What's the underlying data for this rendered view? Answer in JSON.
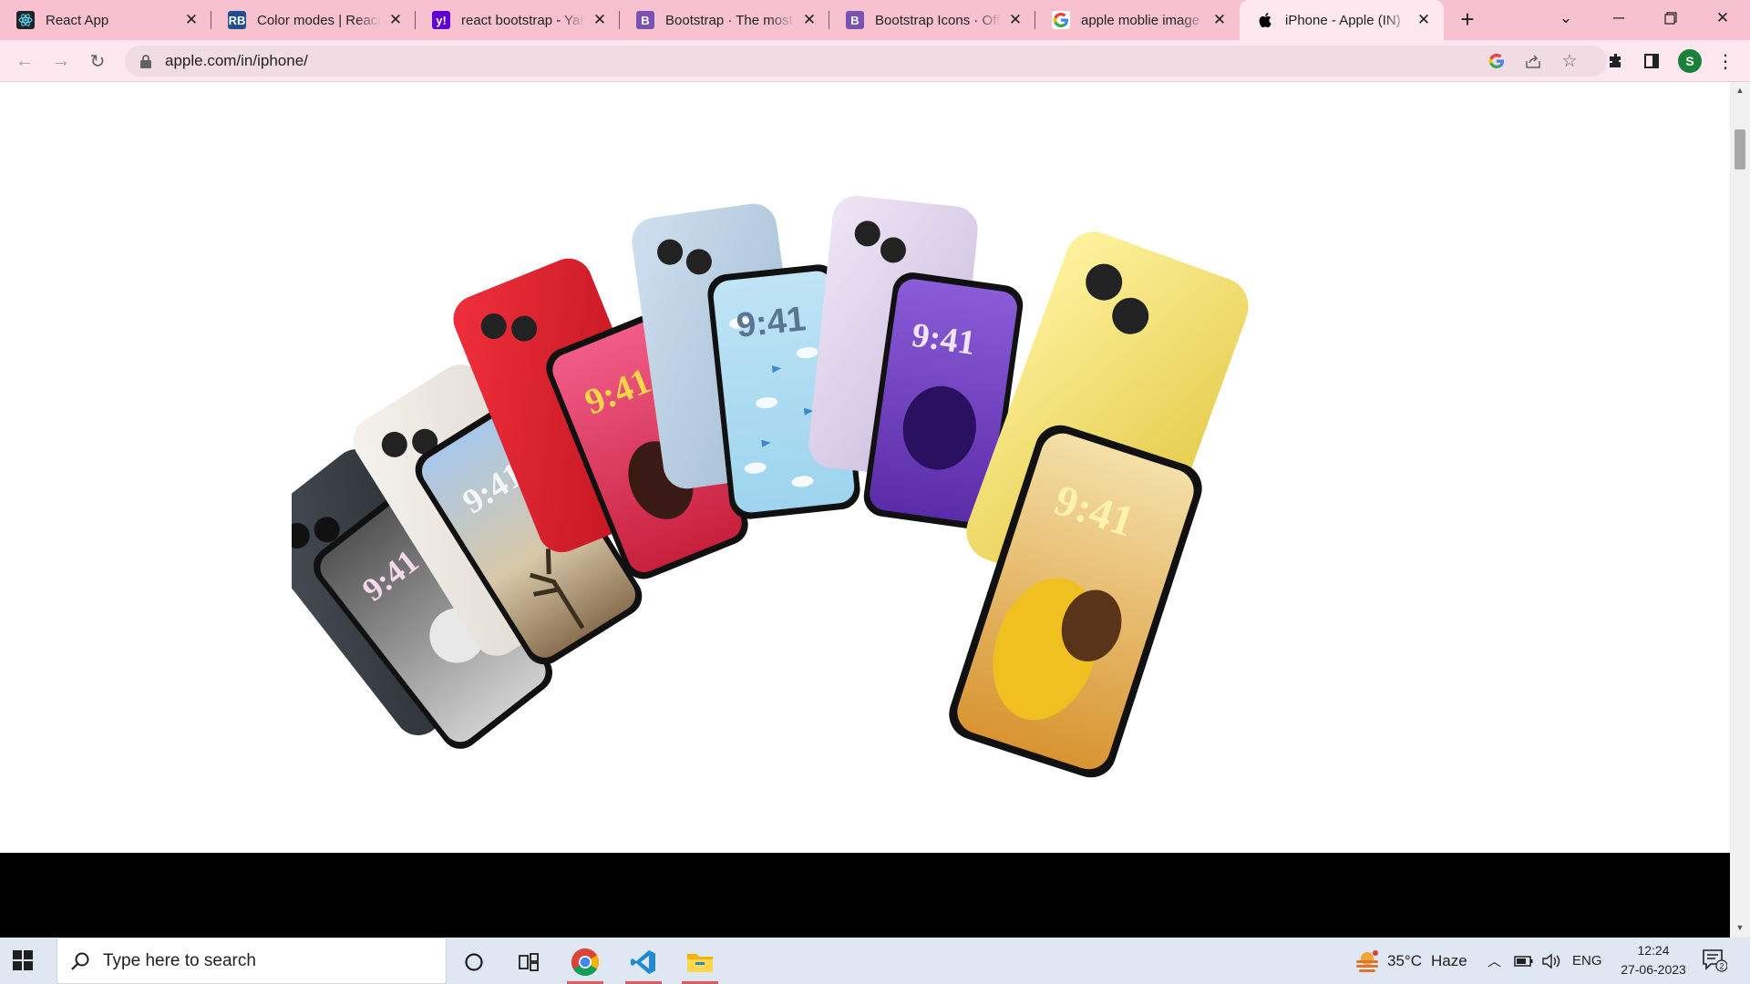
{
  "browser": {
    "tabs": [
      {
        "title": "React App",
        "favicon": "react-icon",
        "favicon_bg": "#20232a",
        "active": false
      },
      {
        "title": "Color modes | React B",
        "favicon": "react-bootstrap-icon",
        "favicon_bg": "#1f4f8f",
        "active": false
      },
      {
        "title": "react bootstrap - Yaho",
        "favicon": "yahoo-icon",
        "favicon_bg": "#6001d2",
        "active": false
      },
      {
        "title": "Bootstrap · The most p",
        "favicon": "bootstrap-icon",
        "favicon_bg": "#7952b3",
        "active": false
      },
      {
        "title": "Bootstrap Icons · Offic",
        "favicon": "bootstrap-icon",
        "favicon_bg": "#7952b3",
        "active": false
      },
      {
        "title": "apple moblie image fo",
        "favicon": "google-icon",
        "favicon_bg": "#ffffff",
        "active": false
      },
      {
        "title": "iPhone - Apple (IN)",
        "favicon": "apple-icon",
        "favicon_bg": "#fce8ee",
        "active": true
      }
    ],
    "new_tab_label": "+",
    "address": "apple.com/in/iphone/",
    "profile_initial": "S",
    "accent_color": "#f7c1cf"
  },
  "page": {
    "hero_alt": "iPhone 14 lineup fanned out",
    "phone_times": [
      "9:41",
      "9:41",
      "9:41",
      "9:41",
      "9:41",
      "9:41"
    ],
    "band_color": "#000000"
  },
  "taskbar": {
    "search_placeholder": "Type here to search",
    "weather_temp": "35°C",
    "weather_desc": "Haze",
    "language": "ENG",
    "time": "12:24",
    "date": "27-06-2023",
    "notification_count": "2"
  }
}
